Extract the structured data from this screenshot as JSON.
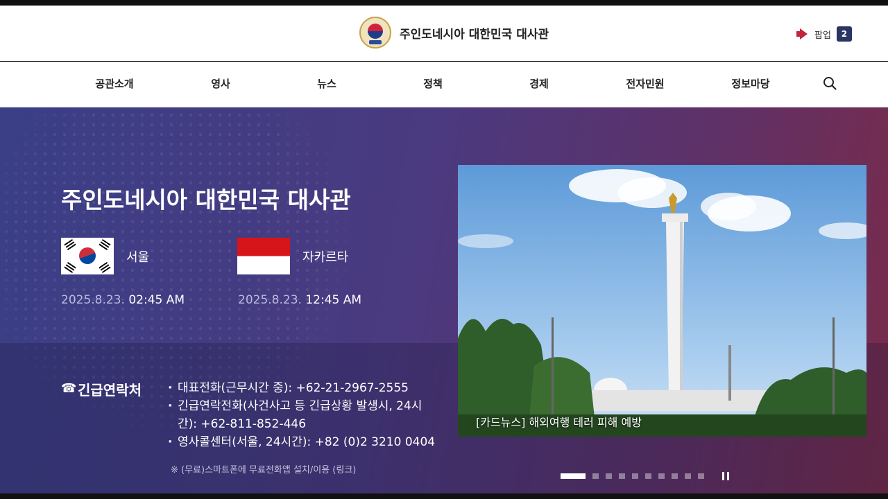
{
  "header": {
    "site_title": "주인도네시아 대한민국 대사관",
    "popup_label": "팝업",
    "popup_count": "2"
  },
  "nav": {
    "items": [
      "공관소개",
      "영사",
      "뉴스",
      "정책",
      "경제",
      "전자민원",
      "정보마당"
    ]
  },
  "hero": {
    "title": "주인도네시아 대한민국 대사관",
    "cities": [
      {
        "name": "서울",
        "date": "2025.8.23.",
        "time": "02:45 AM"
      },
      {
        "name": "자카르타",
        "date": "2025.8.23.",
        "time": "12:45 AM"
      }
    ],
    "contact": {
      "label": "긴급연락처",
      "items": [
        "대표전화(근무시간 중): +62-21-2967-2555",
        "긴급연락전화(사건사고 등 긴급상황 발생시, 24시간): +62-811-852-446",
        "영사콜센터(서울, 24시간): +82 (0)2 3210 0404"
      ],
      "note": "※ (무료)스마트폰에 무료전화앱 설치/이용 (링크)"
    }
  },
  "news": {
    "caption": "[카드뉴스] 해외여행 테러 피해 예방"
  },
  "colors": {
    "accent_navy": "#2a3564",
    "hero_start": "#3a3f86",
    "hero_end": "#7a2b4a"
  }
}
